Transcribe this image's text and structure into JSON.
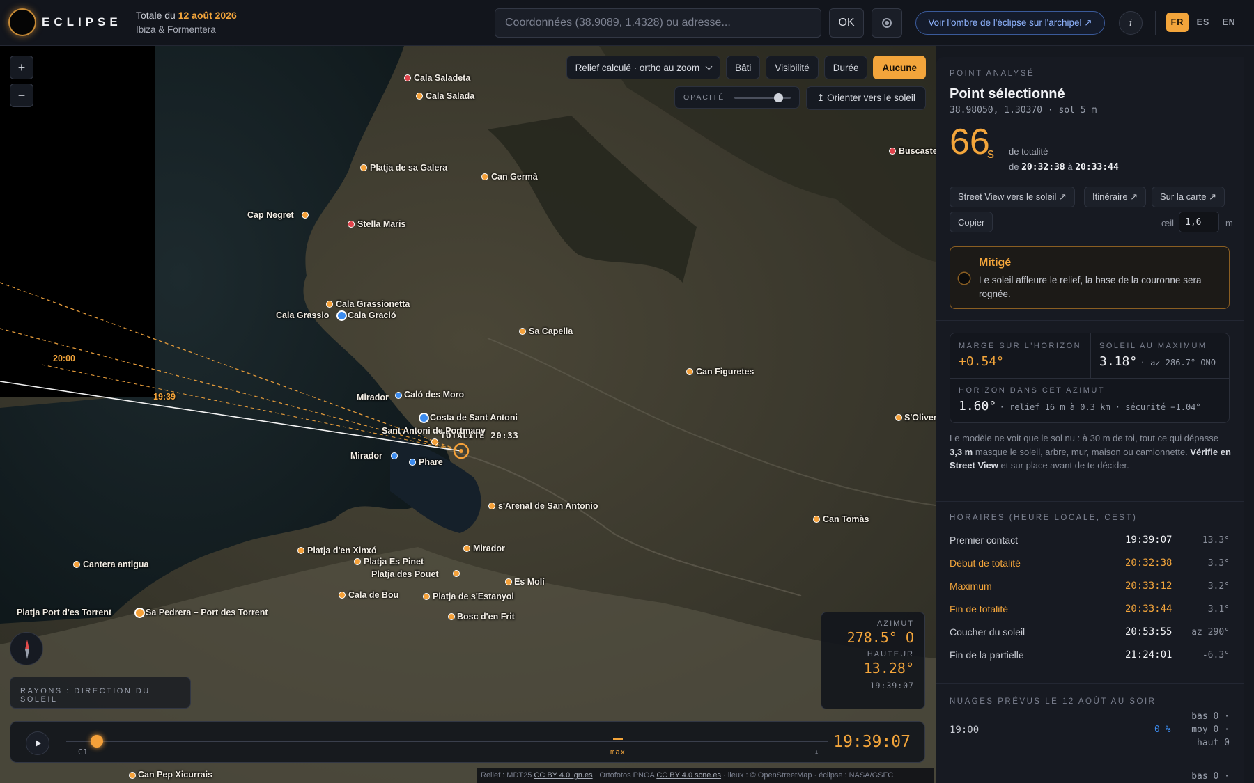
{
  "header": {
    "brand": "ECLIPSE",
    "date_prefix": "Totale du",
    "date": "12 août 2026",
    "place": "Ibiza & Formentera",
    "search_placeholder": "Coordonnées (38.9089, 1.4328) ou adresse...",
    "ok_label": "OK",
    "archipel_label": "Voir l'ombre de l'éclipse sur l'archipel ↗",
    "info_label": "i",
    "languages": [
      "FR",
      "ES",
      "EN"
    ],
    "active_language": "FR"
  },
  "map": {
    "zoom_in": "+",
    "zoom_out": "−",
    "toolbar": {
      "relief_select": "Relief calculé · ortho au zoom",
      "bati": "Bâti",
      "visibilite": "Visibilité",
      "duree": "Durée",
      "aucune": "Aucune"
    },
    "opacity_label": "OPACITÉ",
    "opacity_value": 0.72,
    "orient_button": "↥ Orienter vers le soleil",
    "ray_labels": {
      "r2000": "20:00",
      "r1939": "19:39"
    },
    "totality_label": "TOTALITÉ 20:33",
    "places": [
      {
        "name": "Cala Saladeta",
        "color": "red"
      },
      {
        "name": "Cala Salada",
        "color": "orange"
      },
      {
        "name": "Buscastell",
        "color": "red"
      },
      {
        "name": "Platja de sa Galera",
        "color": "orange"
      },
      {
        "name": "Can Germà",
        "color": "orange"
      },
      {
        "name": "Cap Negret",
        "color": "orange"
      },
      {
        "name": "Stella Maris",
        "color": "red"
      },
      {
        "name": "Cala Grassionetta",
        "color": "orange"
      },
      {
        "name": "Cala Grassio",
        "color": "blue"
      },
      {
        "name": "Cala Gració",
        "color": "blue"
      },
      {
        "name": "Sa Capella",
        "color": "orange"
      },
      {
        "name": "Can Figuretes",
        "color": "orange"
      },
      {
        "name": "Mirador",
        "color": "blue"
      },
      {
        "name": "Caló des Moro",
        "color": "blue"
      },
      {
        "name": "Costa de Sant Antoni",
        "color": "blue"
      },
      {
        "name": "S'Olivera",
        "color": "orange"
      },
      {
        "name": "Sant Antoni de Portmany",
        "color": "orange"
      },
      {
        "name": "Mirador",
        "color": "blue"
      },
      {
        "name": "Phare",
        "color": "blue"
      },
      {
        "name": "s'Arenal de San Antonio",
        "color": "orange"
      },
      {
        "name": "Can Tomàs",
        "color": "orange"
      },
      {
        "name": "Platja d'en Xinxó",
        "color": "orange"
      },
      {
        "name": "Mirador",
        "color": "orange"
      },
      {
        "name": "Cantera antigua",
        "color": "orange"
      },
      {
        "name": "Platja Es Pinet",
        "color": "orange"
      },
      {
        "name": "Platja des Pouet",
        "color": "orange"
      },
      {
        "name": "Es Molí",
        "color": "orange"
      },
      {
        "name": "Cala de Bou",
        "color": "orange"
      },
      {
        "name": "Platja de s'Estanyol",
        "color": "orange"
      },
      {
        "name": "Platja Port d'es Torrent",
        "color": "orange"
      },
      {
        "name": "Sa Pedrera – Port des Torrent",
        "color": "orange"
      },
      {
        "name": "Bosc d'en Frit",
        "color": "orange"
      },
      {
        "name": "Can Pep Xicurrais",
        "color": "orange"
      }
    ],
    "rays_caption": "RAYONS : DIRECTION DU SOLEIL",
    "readout": {
      "azimuth_label": "AZIMUT",
      "azimuth": "278.5° O",
      "altitude_label": "HAUTEUR",
      "altitude": "13.28°",
      "time": "19:39:07"
    },
    "timeline": {
      "c1": "C1",
      "max": "max",
      "end": "↓",
      "current_time": "19:39:07",
      "progress": 0.04
    },
    "attribution": {
      "a": "Relief : MDT25 ",
      "l1": "CC BY 4.0 ign.es",
      "b": " · Ortofotos PNOA ",
      "l2": "CC BY 4.0 scne.es",
      "c": " · lieux : © OpenStreetMap · éclipse : NASA/GSFC"
    }
  },
  "panel": {
    "kicker": "POINT ANALYSÉ",
    "title": "Point sélectionné",
    "coords": "38.98050, 1.30370 · sol 5 m",
    "totality_seconds": "66",
    "seconds_unit": "s",
    "totality_label": "de totalité",
    "range_prefix": "de",
    "range_start": "20:32:38",
    "range_mid": "à",
    "range_end": "20:33:44",
    "buttons": {
      "street_view": "Street View vers le soleil ↗",
      "itineraire": "Itinéraire ↗",
      "sur_carte": "Sur la carte ↗",
      "copier": "Copier"
    },
    "eye_label": "œil",
    "eye_value": "1,6",
    "eye_unit": "m",
    "alert": {
      "title": "Mitigé",
      "text": "Le soleil affleure le relief, la base de la couronne sera rognée.",
      "color": "#f3a53b"
    },
    "margin": {
      "label": "MARGE SUR L'HORIZON",
      "value": "+0.54°"
    },
    "sun_max": {
      "label": "SOLEIL AU MAXIMUM",
      "value": "3.18°",
      "detail": "· az 286.7° ONO"
    },
    "horizon": {
      "label": "HORIZON DANS CET AZIMUT",
      "value": "1.60°",
      "detail": "· relief 16 m à 0.3 km · sécurité −1.04°"
    },
    "note": {
      "a": "Le modèle ne voit que le sol nu : à 30 m de toi, tout ce qui dépasse ",
      "b": "3,3 m",
      "c": " masque le soleil, arbre, mur, maison ou camionnette. ",
      "d": "Vérifie en Street View",
      "e": " et sur place avant de te décider."
    },
    "schedule_label": "HORAIRES (HEURE LOCALE, CEST)",
    "schedule": [
      {
        "name": "Premier contact",
        "time": "19:39:07",
        "alt": "13.3°",
        "hl": false
      },
      {
        "name": "Début de totalité",
        "time": "20:32:38",
        "alt": "3.3°",
        "hl": true
      },
      {
        "name": "Maximum",
        "time": "20:33:12",
        "alt": "3.2°",
        "hl": true
      },
      {
        "name": "Fin de totalité",
        "time": "20:33:44",
        "alt": "3.1°",
        "hl": true
      },
      {
        "name": "Coucher du soleil",
        "time": "20:53:55",
        "alt": "az 290°",
        "hl": false
      },
      {
        "name": "Fin de la partielle",
        "time": "21:24:01",
        "alt": "-6.3°",
        "hl": false
      }
    ],
    "clouds_label": "NUAGES PRÉVUS LE 12 AOÛT AU SOIR",
    "clouds": {
      "time": "19:00",
      "pct": "0 %",
      "bas": "bas 0 ·",
      "moy": "moy 0 ·",
      "haut": "haut 0",
      "bas2": "bas 0 ·"
    }
  }
}
